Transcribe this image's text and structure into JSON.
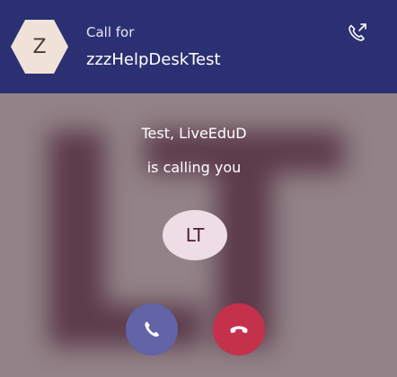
{
  "header": {
    "avatar_initial": "Z",
    "call_for_label": "Call for",
    "target_name": "zzzHelpDeskTest"
  },
  "incoming": {
    "caller_name": "Test, LiveEduD",
    "status_text": "is calling you",
    "caller_initials": "LT"
  },
  "icons": {
    "transfer": "call-forward-icon",
    "accept": "phone-icon",
    "decline": "hang-up-icon"
  },
  "colors": {
    "header_bg": "#2b3073",
    "accept": "#6264a7",
    "decline": "#c4314b"
  }
}
